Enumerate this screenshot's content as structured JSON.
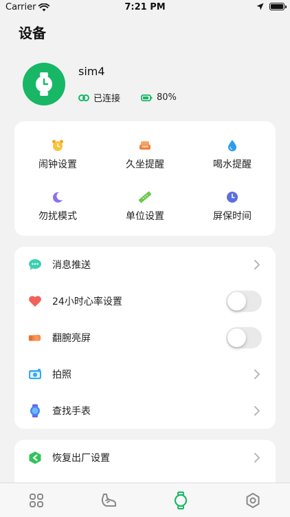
{
  "status_bar": {
    "carrier": "Carrier",
    "time": "7:21 PM"
  },
  "page_title": "设备",
  "device": {
    "name": "sim4",
    "connection": "已连接",
    "battery": "80%",
    "accent_color": "#18b765"
  },
  "grid": [
    {
      "label": "闹钟设置",
      "icon": "alarm-clock-icon"
    },
    {
      "label": "久坐提醒",
      "icon": "sofa-icon"
    },
    {
      "label": "喝水提醒",
      "icon": "water-drop-icon"
    },
    {
      "label": "勿扰模式",
      "icon": "moon-icon"
    },
    {
      "label": "单位设置",
      "icon": "ruler-icon"
    },
    {
      "label": "屏保时间",
      "icon": "clock-icon"
    }
  ],
  "settings": [
    {
      "label": "消息推送",
      "icon": "chat-bubble-icon",
      "control": "chevron"
    },
    {
      "label": "24小时心率设置",
      "icon": "heart-icon",
      "control": "toggle",
      "on": false
    },
    {
      "label": "翻腕亮屏",
      "icon": "wrist-icon",
      "control": "toggle",
      "on": false
    },
    {
      "label": "拍照",
      "icon": "camera-icon",
      "control": "chevron"
    },
    {
      "label": "查找手表",
      "icon": "watch-icon",
      "control": "chevron"
    }
  ],
  "settings2": [
    {
      "label": "恢复出厂设置",
      "icon": "factory-reset-icon",
      "control": "chevron"
    }
  ],
  "tabs": [
    {
      "icon": "dashboard-grid-icon",
      "active": false
    },
    {
      "icon": "shoe-icon",
      "active": false
    },
    {
      "icon": "watch-icon",
      "active": true
    },
    {
      "icon": "settings-hex-icon",
      "active": false
    }
  ]
}
